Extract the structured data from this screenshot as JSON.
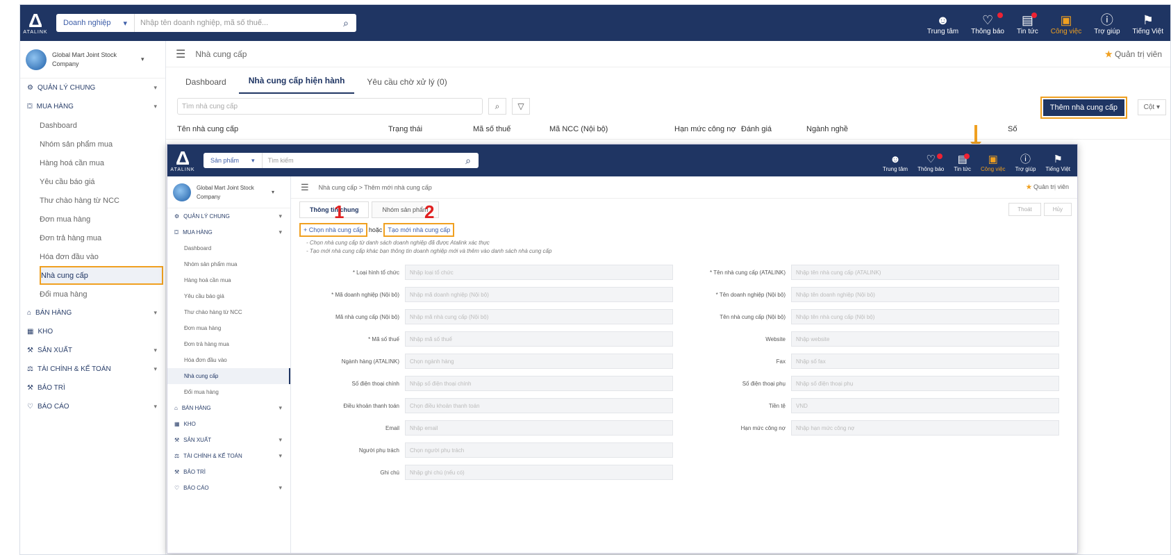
{
  "app": {
    "brand": "ATALINK",
    "logo_glyph": "Δ"
  },
  "topbar": {
    "search_scope": "Doanh nghiệp",
    "search_placeholder": "Nhập tên doanh nghiệp, mã số thuế...",
    "tools": [
      {
        "label": "Trung tâm",
        "icon": "user-icon",
        "glyph": "☻",
        "active": false
      },
      {
        "label": "Thông báo",
        "icon": "bell-icon",
        "glyph": "♡",
        "active": false
      },
      {
        "label": "Tin tức",
        "icon": "news-icon",
        "glyph": "▤",
        "active": false
      },
      {
        "label": "Công việc",
        "icon": "briefcase-icon",
        "glyph": "▣",
        "active": true
      },
      {
        "label": "Trợ giúp",
        "icon": "help-icon",
        "glyph": "ⓘ",
        "active": false
      },
      {
        "label": "Tiếng Việt",
        "icon": "flag-icon",
        "glyph": "⚑",
        "active": false
      }
    ]
  },
  "company": {
    "name": "Global Mart Joint Stock Company"
  },
  "sidebar": {
    "groups": [
      {
        "label": "Quản lý chung",
        "icon": "gear-icon",
        "glyph": "⚙"
      },
      {
        "label": "Mua hàng",
        "icon": "cart-icon",
        "glyph": "⛋"
      }
    ],
    "subs": [
      "Dashboard",
      "Nhóm sản phẩm mua",
      "Hàng hoá cần mua",
      "Yêu cầu báo giá",
      "Thư chào hàng từ NCC",
      "Đơn mua hàng",
      "Đơn trả hàng mua",
      "Hóa đơn đầu vào",
      "Nhà cung cấp",
      "Đổi mua hàng"
    ],
    "groups_after": [
      {
        "label": "Bán hàng",
        "icon": "store-icon",
        "glyph": "⌂"
      },
      {
        "label": "Kho",
        "icon": "warehouse-icon",
        "glyph": "▦"
      },
      {
        "label": "Sản xuất",
        "icon": "factory-icon",
        "glyph": "⚒"
      },
      {
        "label": "Tài chính & Kế toán",
        "icon": "finance-icon",
        "glyph": "⚖"
      },
      {
        "label": "Bảo trì",
        "icon": "wrench-icon",
        "glyph": "⚒"
      },
      {
        "label": "Báo cáo",
        "icon": "report-icon",
        "glyph": "♡"
      }
    ]
  },
  "page": {
    "breadcrumb": "Nhà cung cấp",
    "admin": "Quản trị viên"
  },
  "tabs": [
    "Dashboard",
    "Nhà cung cấp hiện hành",
    "Yêu cầu chờ xử lý (0)"
  ],
  "list": {
    "search_placeholder": "Tìm nhà cung cấp",
    "add_button": "Thêm nhà cung cấp",
    "column_select": "Cột",
    "headers": [
      "Tên nhà cung cấp",
      "Trạng thái",
      "Mã số thuế",
      "Mã NCC (Nội bộ)",
      "Hạn mức công nợ",
      "Đánh giá",
      "Ngành nghề",
      "Số"
    ]
  },
  "inset": {
    "search_scope": "Sản phẩm",
    "search_placeholder": "Tìm kiếm",
    "breadcrumb": "Nhà cung cấp  >  Thêm mới nhà cung cấp",
    "tabs": [
      "Thông tin chung",
      "Nhóm sản phẩm"
    ],
    "buttons": [
      "Thoát",
      "Hủy"
    ],
    "step1": "1",
    "step2": "2",
    "choice1": "+ Chọn nhà cung cấp",
    "or": "hoặc",
    "choice2": "Tạo mới nhà cung cấp",
    "notes": [
      "- Chọn nhà cung cấp từ danh sách doanh nghiệp đã được Atalink xác thực",
      "- Tạo mới nhà cung cấp khác bạn thông tin doanh nghiệp mới và thêm vào danh sách nhà cung cấp"
    ],
    "form": [
      [
        {
          "label": "* Loại hình tổ chức",
          "ph": "Nhập loại tổ chức"
        },
        {
          "label": "* Tên nhà cung cấp (ATALINK)",
          "ph": "Nhập tên nhà cung cấp (ATALINK)"
        }
      ],
      [
        {
          "label": "* Mã doanh nghiệp (Nội bộ)",
          "ph": "Nhập mã doanh nghiệp (Nội bộ)"
        },
        {
          "label": "* Tên doanh nghiệp (Nội bộ)",
          "ph": "Nhập tên doanh nghiệp (Nội bộ)"
        }
      ],
      [
        {
          "label": "Mã nhà cung cấp (Nội bộ)",
          "ph": "Nhập mã nhà cung cấp (Nội bộ)"
        },
        {
          "label": "Tên nhà cung cấp (Nội bộ)",
          "ph": "Nhập tên nhà cung cấp (Nội bộ)"
        }
      ],
      [
        {
          "label": "* Mã số thuế",
          "ph": "Nhập mã số thuế"
        },
        {
          "label": "Website",
          "ph": "Nhập website"
        }
      ],
      [
        {
          "label": "Ngành hàng (ATALINK)",
          "ph": "Chọn ngành hàng"
        },
        {
          "label": "Fax",
          "ph": "Nhập số fax"
        }
      ],
      [
        {
          "label": "Số điện thoại chính",
          "ph": "Nhập số điện thoại chính"
        },
        {
          "label": "Số điện thoại phụ",
          "ph": "Nhập số điện thoại phụ"
        }
      ],
      [
        {
          "label": "Điều khoản thanh toán",
          "ph": "Chọn điều khoản thanh toán"
        },
        {
          "label": "Tiền tệ",
          "ph": "VND"
        }
      ],
      [
        {
          "label": "Email",
          "ph": "Nhập email"
        },
        {
          "label": "Hạn mức công nợ",
          "ph": "Nhập hạn mức công nợ"
        }
      ],
      [
        {
          "label": "Người phụ trách",
          "ph": "Chọn người phụ trách"
        },
        {
          "label": "",
          "ph": ""
        }
      ],
      [
        {
          "label": "Ghi chú",
          "ph": "Nhập ghi chú (nếu có)"
        },
        {
          "label": "",
          "ph": ""
        }
      ]
    ]
  },
  "colors": {
    "navy": "#1f3563",
    "accent": "#f0a020",
    "step": "#e02020"
  }
}
